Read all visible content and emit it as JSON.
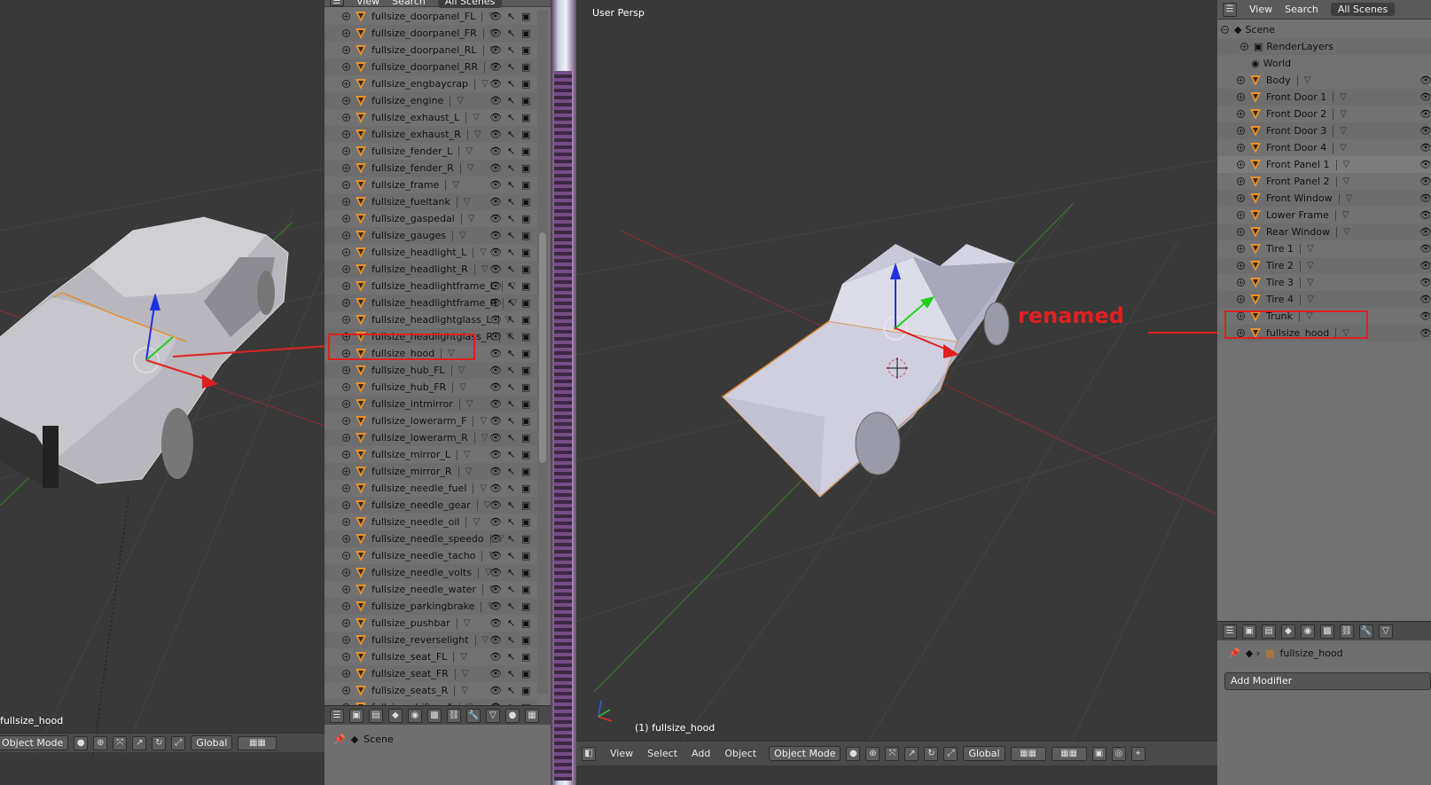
{
  "left_viewport": {
    "object_label": "fullsize_hood",
    "mode": "Object Mode",
    "orientation": "Global"
  },
  "middle_outliner": {
    "header": {
      "view": "View",
      "search": "Search",
      "scenes": "All Scenes"
    },
    "items": [
      "fullsize_doorpanel_FL",
      "fullsize_doorpanel_FR",
      "fullsize_doorpanel_RL",
      "fullsize_doorpanel_RR",
      "fullsize_engbaycrap",
      "fullsize_engine",
      "fullsize_exhaust_L",
      "fullsize_exhaust_R",
      "fullsize_fender_L",
      "fullsize_fender_R",
      "fullsize_frame",
      "fullsize_fueltank",
      "fullsize_gaspedal",
      "fullsize_gauges",
      "fullsize_headlight_L",
      "fullsize_headlight_R",
      "fullsize_headlightframe_L",
      "fullsize_headlightframe_R",
      "fullsize_headlightglass_L",
      "fullsize_headlightglass_R",
      "fullsize_hood",
      "fullsize_hub_FL",
      "fullsize_hub_FR",
      "fullsize_intmirror",
      "fullsize_lowerarm_F",
      "fullsize_lowerarm_R",
      "fullsize_mirror_L",
      "fullsize_mirror_R",
      "fullsize_needle_fuel",
      "fullsize_needle_gear",
      "fullsize_needle_oil",
      "fullsize_needle_speedo",
      "fullsize_needle_tacho",
      "fullsize_needle_volts",
      "fullsize_needle_water",
      "fullsize_parkingbrake",
      "fullsize_pushbar",
      "fullsize_reverselight",
      "fullsize_seat_FL",
      "fullsize_seat_FR",
      "fullsize_seats_R",
      "fullsize_shifter_A"
    ],
    "properties_scene": "Scene"
  },
  "center_viewport": {
    "view_name": "User Persp",
    "object_label": "(1) fullsize_hood",
    "annotation": "renamed",
    "menu": {
      "view": "View",
      "select": "Select",
      "add": "Add",
      "object": "Object"
    },
    "mode": "Object Mode",
    "orientation": "Global"
  },
  "right_outliner": {
    "header": {
      "view": "View",
      "search": "Search",
      "scenes": "All Scenes"
    },
    "scene": "Scene",
    "render_layers": "RenderLayers",
    "world": "World",
    "items": [
      "Body",
      "Front Door 1",
      "Front Door 2",
      "Front Door 3",
      "Front Door 4",
      "Front Panel 1",
      "Front Panel 2",
      "Front Window",
      "Lower Frame",
      "Rear Window",
      "Tire 1",
      "Tire 2",
      "Tire 3",
      "Tire 4",
      "Trunk",
      "fullsize_hood"
    ],
    "properties_object": "fullsize_hood",
    "add_modifier": "Add Modifier"
  }
}
